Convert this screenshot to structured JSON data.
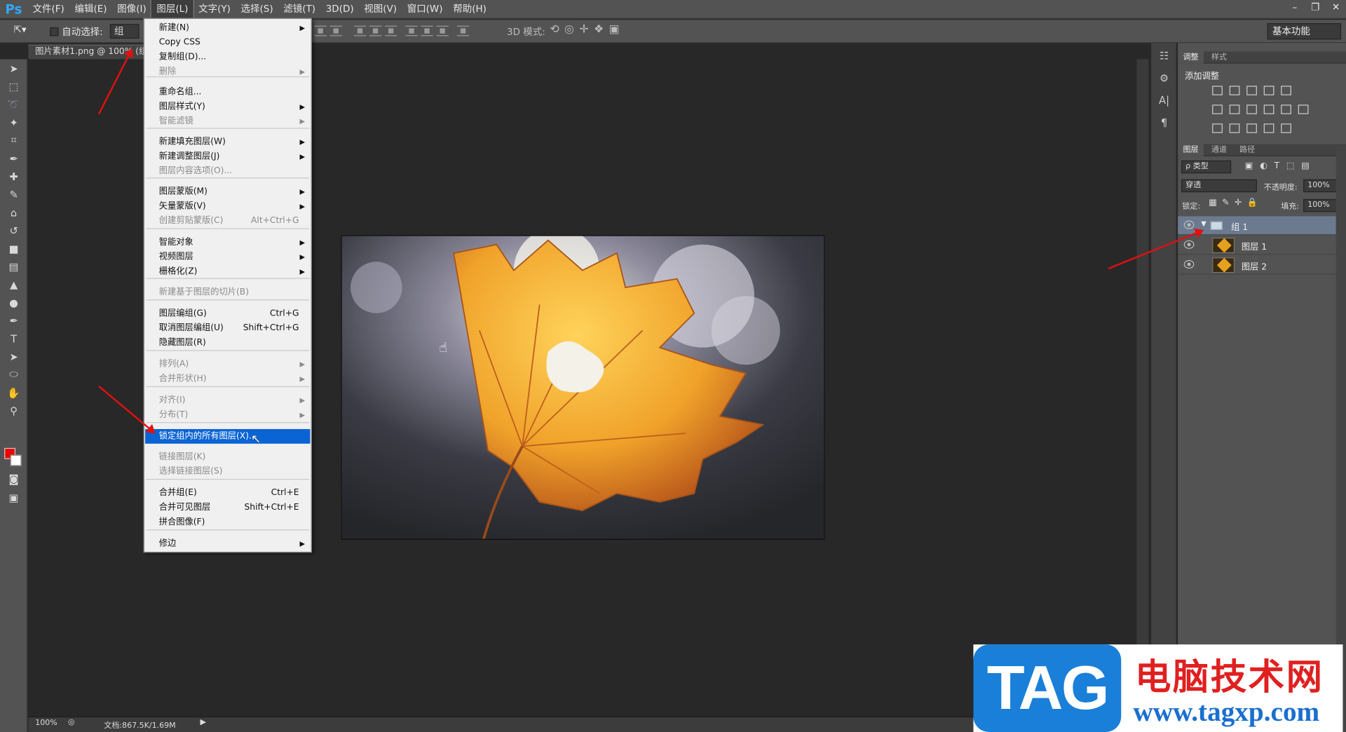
{
  "app": {
    "logo": "Ps"
  },
  "menubar": {
    "items": [
      {
        "label": "文件(F)"
      },
      {
        "label": "编辑(E)"
      },
      {
        "label": "图像(I)"
      },
      {
        "label": "图层(L)"
      },
      {
        "label": "文字(Y)"
      },
      {
        "label": "选择(S)"
      },
      {
        "label": "滤镜(T)"
      },
      {
        "label": "3D(D)"
      },
      {
        "label": "视图(V)"
      },
      {
        "label": "窗口(W)"
      },
      {
        "label": "帮助(H)"
      }
    ],
    "active": "图层(L)"
  },
  "options_bar": {
    "auto_select_label": "自动选择:",
    "auto_select_value": "组",
    "mode_3d_label": "3D 模式:",
    "workspace": "基本功能"
  },
  "document": {
    "tab_title": "图片素材1.png @ 100% (组",
    "zoom": "100%",
    "doc_info": "文档:867.5K/1.69M"
  },
  "layer_menu": {
    "items": [
      {
        "label": "新建(N)",
        "shortcut": "",
        "submenu": true,
        "disabled": false
      },
      {
        "label": "Copy CSS",
        "shortcut": "",
        "submenu": false,
        "disabled": false
      },
      {
        "label": "复制组(D)...",
        "shortcut": "",
        "submenu": false,
        "disabled": false
      },
      {
        "label": "删除",
        "shortcut": "",
        "submenu": true,
        "disabled": true
      },
      {
        "label": "重命名组...",
        "shortcut": "",
        "submenu": false,
        "disabled": false
      },
      {
        "label": "图层样式(Y)",
        "shortcut": "",
        "submenu": true,
        "disabled": false
      },
      {
        "label": "智能滤镜",
        "shortcut": "",
        "submenu": true,
        "disabled": true
      },
      {
        "label": "新建填充图层(W)",
        "shortcut": "",
        "submenu": true,
        "disabled": false
      },
      {
        "label": "新建调整图层(J)",
        "shortcut": "",
        "submenu": true,
        "disabled": false
      },
      {
        "label": "图层内容选项(O)...",
        "shortcut": "",
        "submenu": false,
        "disabled": true
      },
      {
        "label": "图层蒙版(M)",
        "shortcut": "",
        "submenu": true,
        "disabled": false
      },
      {
        "label": "矢量蒙版(V)",
        "shortcut": "",
        "submenu": true,
        "disabled": false
      },
      {
        "label": "创建剪贴蒙版(C)",
        "shortcut": "Alt+Ctrl+G",
        "submenu": false,
        "disabled": true
      },
      {
        "label": "智能对象",
        "shortcut": "",
        "submenu": true,
        "disabled": false
      },
      {
        "label": "视频图层",
        "shortcut": "",
        "submenu": true,
        "disabled": false
      },
      {
        "label": "栅格化(Z)",
        "shortcut": "",
        "submenu": true,
        "disabled": false
      },
      {
        "label": "新建基于图层的切片(B)",
        "shortcut": "",
        "submenu": false,
        "disabled": true
      },
      {
        "label": "图层编组(G)",
        "shortcut": "Ctrl+G",
        "submenu": false,
        "disabled": false
      },
      {
        "label": "取消图层编组(U)",
        "shortcut": "Shift+Ctrl+G",
        "submenu": false,
        "disabled": false
      },
      {
        "label": "隐藏图层(R)",
        "shortcut": "",
        "submenu": false,
        "disabled": false
      },
      {
        "label": "排列(A)",
        "shortcut": "",
        "submenu": true,
        "disabled": true
      },
      {
        "label": "合并形状(H)",
        "shortcut": "",
        "submenu": true,
        "disabled": true
      },
      {
        "label": "对齐(I)",
        "shortcut": "",
        "submenu": true,
        "disabled": true
      },
      {
        "label": "分布(T)",
        "shortcut": "",
        "submenu": true,
        "disabled": true
      },
      {
        "label": "锁定组内的所有图层(X)...",
        "shortcut": "",
        "submenu": false,
        "disabled": false,
        "highlighted": true
      },
      {
        "label": "链接图层(K)",
        "shortcut": "",
        "submenu": false,
        "disabled": true
      },
      {
        "label": "选择链接图层(S)",
        "shortcut": "",
        "submenu": false,
        "disabled": true
      },
      {
        "label": "合并组(E)",
        "shortcut": "Ctrl+E",
        "submenu": false,
        "disabled": false
      },
      {
        "label": "合并可见图层",
        "shortcut": "Shift+Ctrl+E",
        "submenu": false,
        "disabled": false
      },
      {
        "label": "拼合图像(F)",
        "shortcut": "",
        "submenu": false,
        "disabled": false
      },
      {
        "label": "修边",
        "shortcut": "",
        "submenu": true,
        "disabled": false
      }
    ]
  },
  "adjust_panel": {
    "tabs": [
      "调整",
      "样式"
    ],
    "title": "添加调整"
  },
  "layers_panel": {
    "tabs": [
      "图层",
      "通道",
      "路径"
    ],
    "filter_label": "ρ 类型",
    "blend_mode": "穿透",
    "opacity_label": "不透明度:",
    "opacity": "100%",
    "lock_label": "锁定:",
    "fill_label": "填充:",
    "fill": "100%",
    "layers": [
      {
        "name": "组 1",
        "type": "group",
        "selected": true
      },
      {
        "name": "图层 1",
        "type": "layer",
        "selected": false
      },
      {
        "name": "图层 2",
        "type": "layer",
        "selected": false
      }
    ]
  },
  "watermark": {
    "tag": "TAG",
    "site_name": "电脑技术网",
    "url": "www.tagxp.com"
  },
  "colors": {
    "menu_highlight": "#0a64d4",
    "arrow": "#e01010",
    "foreground": "#ee0000",
    "background": "#ffffff"
  }
}
